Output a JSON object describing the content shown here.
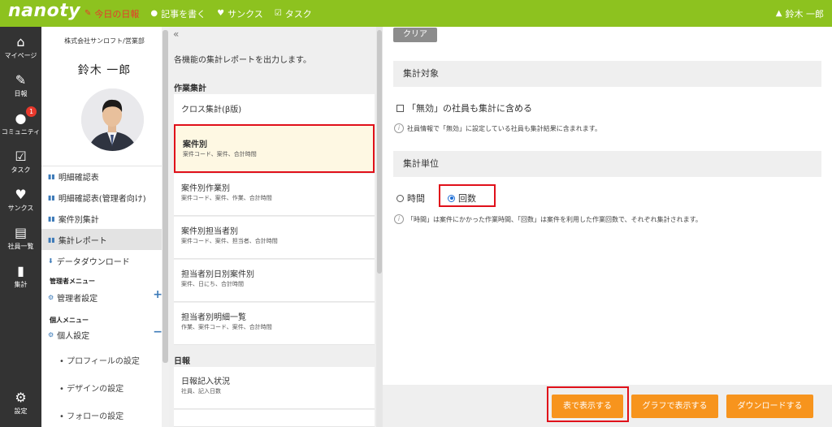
{
  "app": {
    "logo": "nanoty"
  },
  "topnav": [
    {
      "label": "今日の日報",
      "icon": "edit-icon",
      "active": true
    },
    {
      "label": "記事を書く",
      "icon": "chat-icon",
      "active": false
    },
    {
      "label": "サンクス",
      "icon": "heart-icon",
      "active": false
    },
    {
      "label": "タスク",
      "icon": "task-icon",
      "active": false
    }
  ],
  "user": {
    "name": "鈴木 一郎",
    "icon": "user-icon"
  },
  "rail": [
    {
      "label": "マイページ",
      "icon": "home-icon"
    },
    {
      "label": "日報",
      "icon": "report-icon"
    },
    {
      "label": "コミュニティ",
      "icon": "community-icon",
      "badge": "1"
    },
    {
      "label": "タスク",
      "icon": "task-icon"
    },
    {
      "label": "サンクス",
      "icon": "heart-icon"
    },
    {
      "label": "社員一覧",
      "icon": "employee-list-icon"
    },
    {
      "label": "集計",
      "icon": "aggregate-icon"
    },
    {
      "label": "設定",
      "icon": "gear-icon"
    }
  ],
  "profile": {
    "company": "株式会社サンロフト/営業部",
    "name": "鈴木 一郎"
  },
  "menu": {
    "items": [
      {
        "label": "明細確認表",
        "icon": "bar-chart-icon"
      },
      {
        "label": "明細確認表(管理者向け)",
        "icon": "bar-chart-icon"
      },
      {
        "label": "案件別集計",
        "icon": "bar-chart-icon"
      },
      {
        "label": "集計レポート",
        "icon": "bar-chart-icon"
      },
      {
        "label": "データダウンロード",
        "icon": "download-icon"
      }
    ],
    "admin_header": "管理者メニュー",
    "admin_settings": "管理者設定",
    "personal_header": "個人メニュー",
    "personal_settings": "個人設定",
    "sub_items": [
      "プロフィールの設定",
      "デザインの設定",
      "フォローの設定"
    ]
  },
  "reports": {
    "collapse_icon": "«",
    "description": "各機能の集計レポートを出力します。",
    "section_work": "作業集計",
    "cards": [
      {
        "title": "クロス集計(β版)",
        "sub": ""
      },
      {
        "title": "案件別",
        "sub": "案件コード、案件、合計時間",
        "selected": true
      },
      {
        "title": "案件別作業別",
        "sub": "案件コード、案件、作業、合計時間"
      },
      {
        "title": "案件別担当者別",
        "sub": "案件コード、案件、担当者、合計時間"
      },
      {
        "title": "担当者別日別案件別",
        "sub": "案件、日にち、合計時間"
      },
      {
        "title": "担当者別明細一覧",
        "sub": "作業、案件コード、案件、合計時間"
      }
    ],
    "section_daily": "日報",
    "daily_cards": [
      {
        "title": "日報記入状況",
        "sub": "社員、記入日数"
      }
    ]
  },
  "settings": {
    "clear_label": "クリア",
    "target_header": "集計対象",
    "include_invalid_label": "「無効」の社員も集計に含める",
    "include_invalid_note": "社員情報で「無効」に設定している社員も集計結果に含まれます。",
    "unit_header": "集計単位",
    "unit_options": [
      "時間",
      "回数"
    ],
    "unit_selected": "回数",
    "unit_note": "「時間」は案件にかかった作業時間、「回数」は案件を利用した作業回数で、それぞれ集計されます。",
    "buttons": {
      "table": "表で表示する",
      "graph": "グラフで表示する",
      "download": "ダウンロードする"
    }
  },
  "colors": {
    "topbar": "#8dc21f",
    "rail": "#333333",
    "accent": "#f7941d",
    "highlight": "#e0101a",
    "link": "#3c7ab8"
  }
}
